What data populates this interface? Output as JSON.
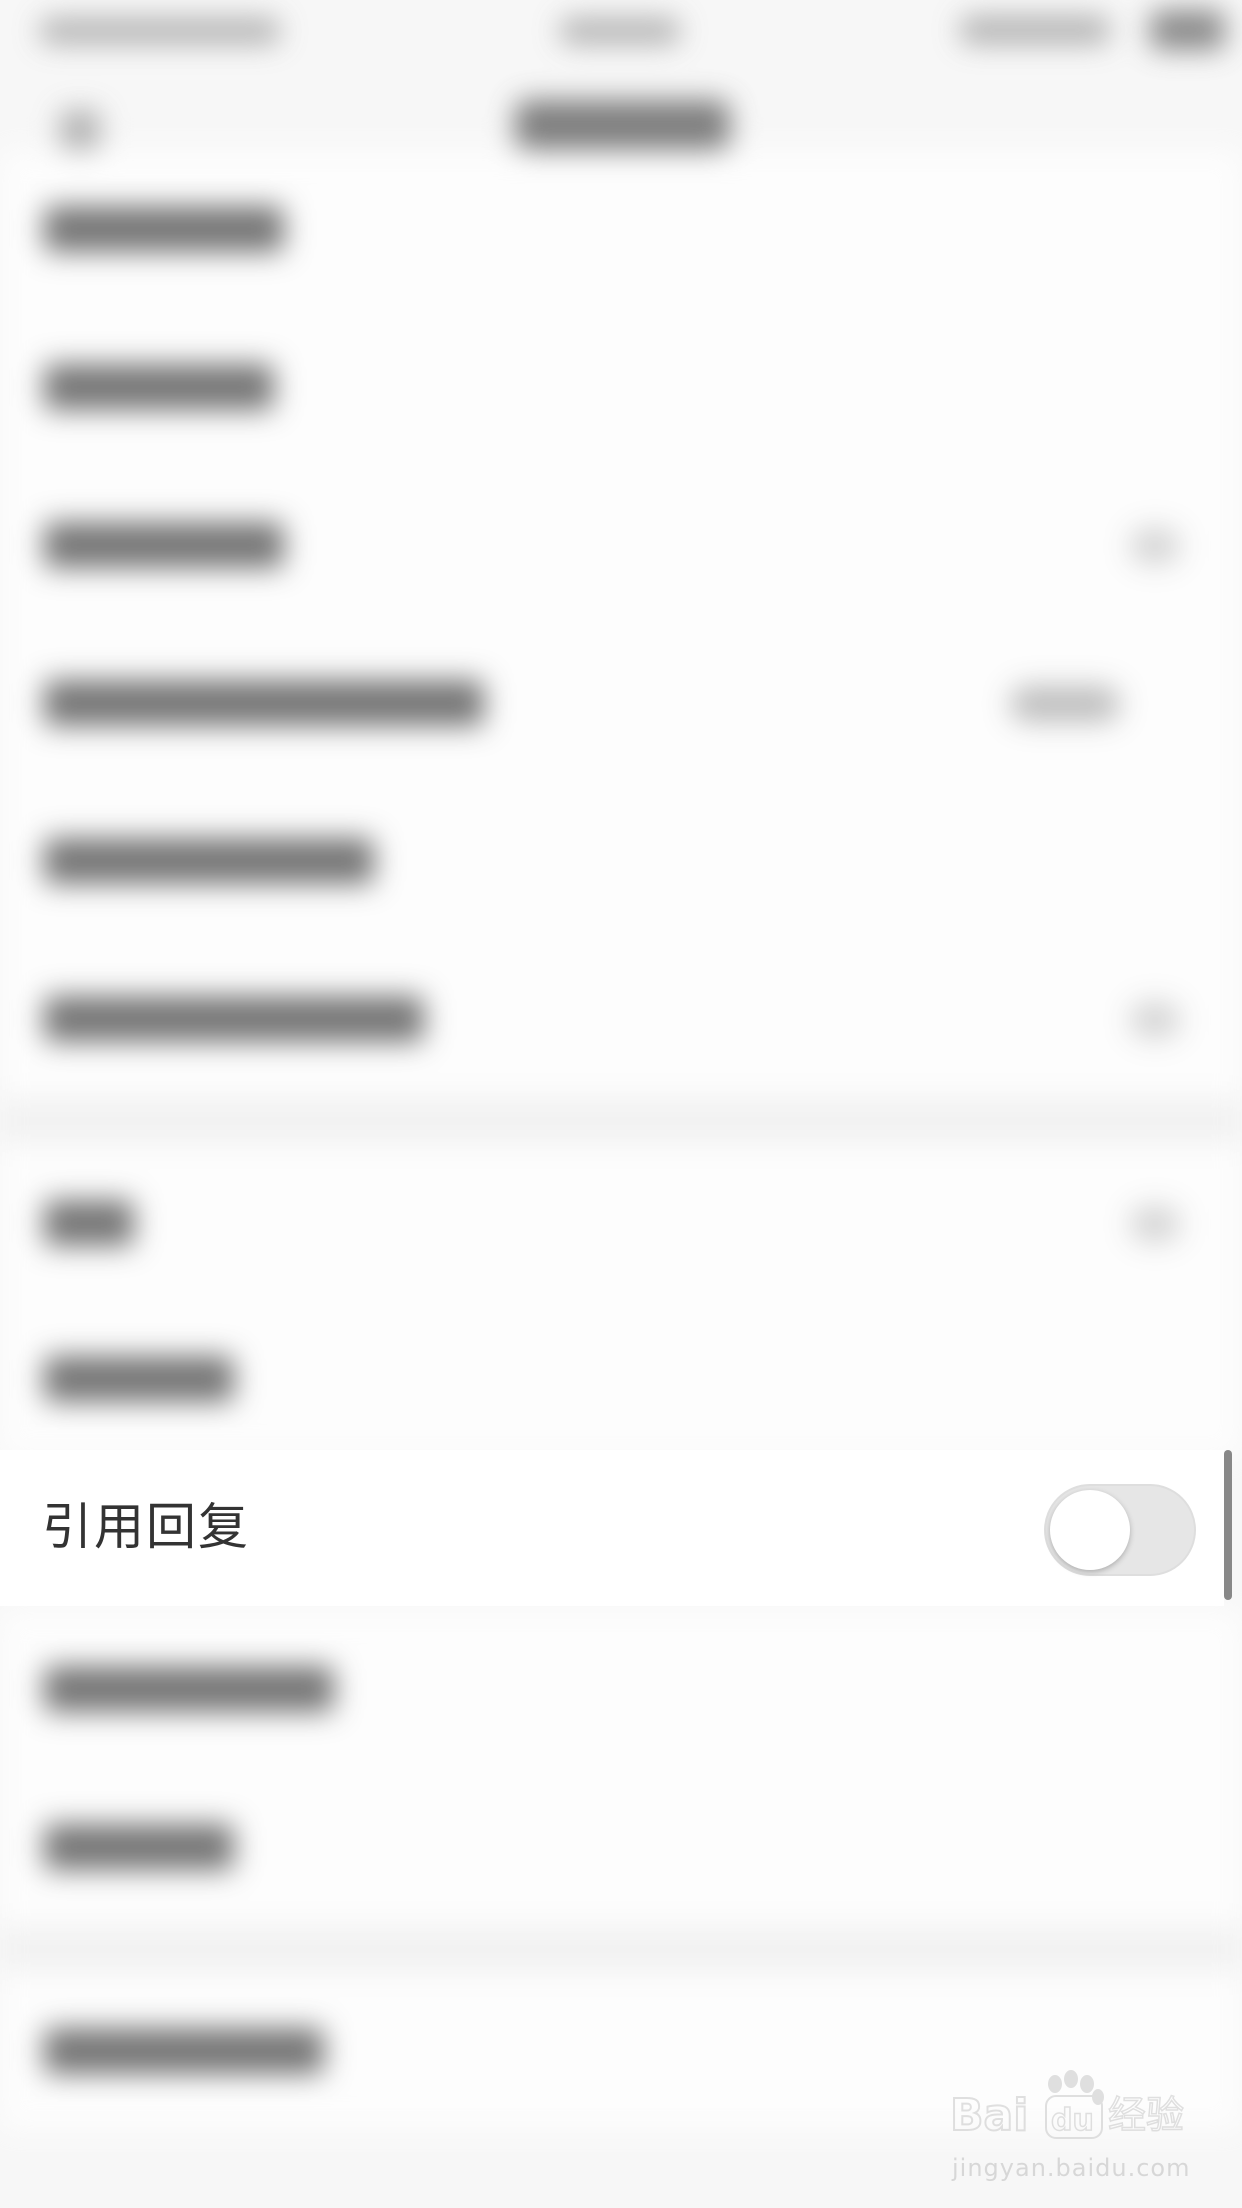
{
  "settings_row": {
    "label": "引用回复",
    "toggle_state": "off"
  },
  "watermark": {
    "brand_text": "Baidu 经验",
    "url": "jingyan.baidu.com"
  }
}
